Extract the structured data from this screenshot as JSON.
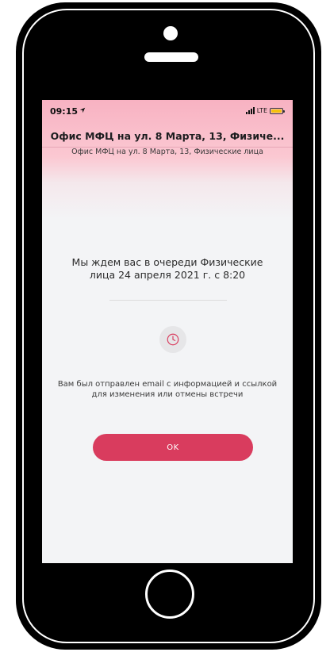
{
  "status_bar": {
    "time": "09:15",
    "network": "LTE",
    "location_icon": "location-arrow-icon",
    "battery_color": "#f4c20d"
  },
  "header": {
    "title": "Офис МФЦ на ул. 8 Марта, 13, Физиче...",
    "subtitle": "Офис МФЦ на ул. 8 Марта, 13, Физические лица"
  },
  "main": {
    "message": "Мы ждем вас в очереди Физические лица 24 апреля 2021 г. с 8:20",
    "icon": "clock-icon",
    "email_note": "Вам был отправлен email с информацией и ссылкой для изменения или отмены встречи",
    "ok_label": "OK"
  },
  "colors": {
    "accent": "#d93c5e",
    "header_gradient_top": "#f8b2c2",
    "background": "#f3f4f6"
  }
}
